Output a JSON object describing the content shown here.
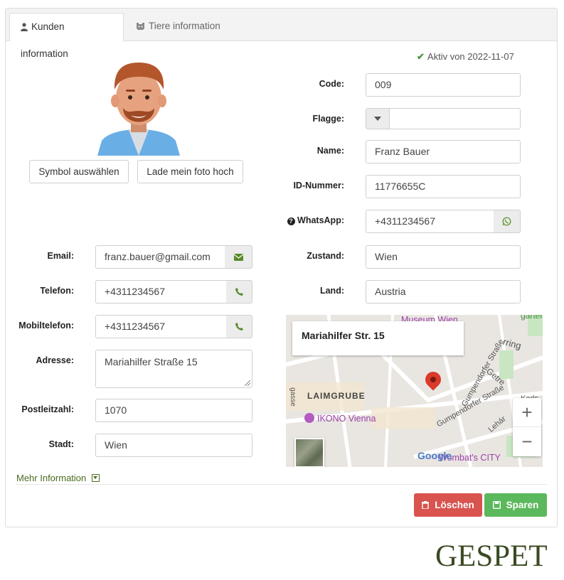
{
  "tabs": [
    {
      "label": "Kunden information",
      "icon": "user-icon",
      "active": true
    },
    {
      "label": "Tiere information",
      "icon": "paw-icon",
      "active": false
    }
  ],
  "status": {
    "text": "Aktiv von 2022-11-07",
    "color": "#4a9a3a"
  },
  "avatar": {
    "buttons": {
      "choose_symbol": "Symbol auswählen",
      "upload_photo": "Lade mein foto hoch"
    }
  },
  "right_form": {
    "code": {
      "label": "Code:",
      "value": "009"
    },
    "flag": {
      "label": "Flagge:",
      "value": ""
    },
    "name": {
      "label": "Name:",
      "value": "Franz Bauer"
    },
    "id_number": {
      "label": "ID-Nummer:",
      "value": "11776655C"
    },
    "whatsapp": {
      "label": "WhatsApp:",
      "value": "+4311234567"
    },
    "state": {
      "label": "Zustand:",
      "value": "Wien"
    },
    "country": {
      "label": "Land:",
      "value": "Austria"
    }
  },
  "left_form": {
    "email": {
      "label": "Email:",
      "value": "franz.bauer@gmail.com"
    },
    "phone": {
      "label": "Telefon:",
      "value": "+4311234567"
    },
    "mobile": {
      "label": "Mobiltelefon:",
      "value": "+4311234567"
    },
    "address": {
      "label": "Adresse:",
      "value": "Mariahilfer Straße 15"
    },
    "zip": {
      "label": "Postleitzahl:",
      "value": "1070"
    },
    "city": {
      "label": "Stadt:",
      "value": "Wien"
    }
  },
  "map": {
    "infobox": "Mariahilfer Str. 15",
    "poi_museum": "Museum Wien",
    "poi_ikono": "IKONO Vienna",
    "area": "LAIMGRUBE",
    "street_gumpendorfer": "Gumpendorfer Straße",
    "street_gumpendorfer2": "Gumpendorfer Straße",
    "poi_wombat": "Wombat's CITY",
    "google": "Google",
    "street_karls": "Karls",
    "street_lehar": "Lehár",
    "street_gasse": "gasse",
    "fragment_agarten": "garten",
    "fragment_rring": "rring",
    "fragment_getre": "Getre",
    "zoom_in": "+",
    "zoom_out": "−"
  },
  "more_info": "Mehr Information",
  "buttons": {
    "delete": "Löschen",
    "save": "Sparen"
  },
  "logo": "GESPET",
  "colors": {
    "danger": "#d9534f",
    "success": "#5cb85c",
    "accent_green": "#4a6a1f"
  }
}
